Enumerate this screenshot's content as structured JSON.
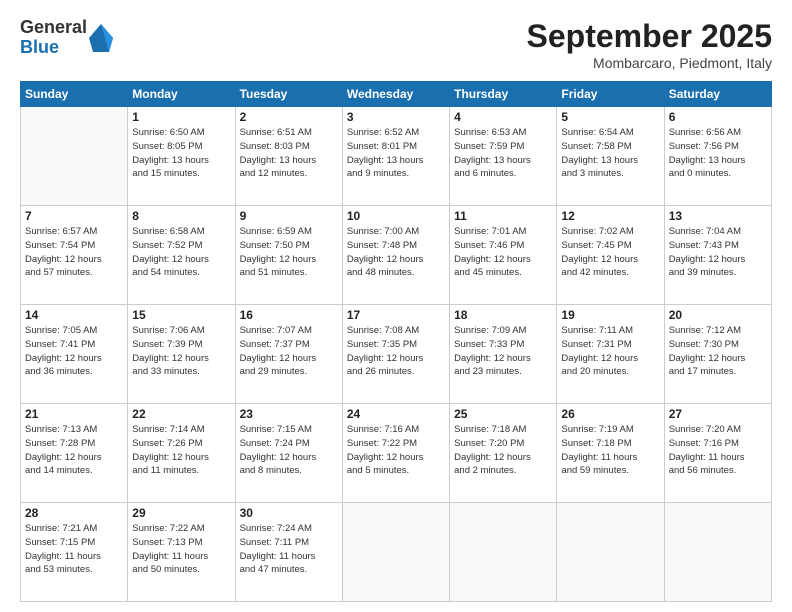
{
  "header": {
    "logo": {
      "general": "General",
      "blue": "Blue"
    },
    "title": "September 2025",
    "location": "Mombarcaro, Piedmont, Italy"
  },
  "weekdays": [
    "Sunday",
    "Monday",
    "Tuesday",
    "Wednesday",
    "Thursday",
    "Friday",
    "Saturday"
  ],
  "weeks": [
    [
      {
        "day": "",
        "info": ""
      },
      {
        "day": "1",
        "info": "Sunrise: 6:50 AM\nSunset: 8:05 PM\nDaylight: 13 hours\nand 15 minutes."
      },
      {
        "day": "2",
        "info": "Sunrise: 6:51 AM\nSunset: 8:03 PM\nDaylight: 13 hours\nand 12 minutes."
      },
      {
        "day": "3",
        "info": "Sunrise: 6:52 AM\nSunset: 8:01 PM\nDaylight: 13 hours\nand 9 minutes."
      },
      {
        "day": "4",
        "info": "Sunrise: 6:53 AM\nSunset: 7:59 PM\nDaylight: 13 hours\nand 6 minutes."
      },
      {
        "day": "5",
        "info": "Sunrise: 6:54 AM\nSunset: 7:58 PM\nDaylight: 13 hours\nand 3 minutes."
      },
      {
        "day": "6",
        "info": "Sunrise: 6:56 AM\nSunset: 7:56 PM\nDaylight: 13 hours\nand 0 minutes."
      }
    ],
    [
      {
        "day": "7",
        "info": "Sunrise: 6:57 AM\nSunset: 7:54 PM\nDaylight: 12 hours\nand 57 minutes."
      },
      {
        "day": "8",
        "info": "Sunrise: 6:58 AM\nSunset: 7:52 PM\nDaylight: 12 hours\nand 54 minutes."
      },
      {
        "day": "9",
        "info": "Sunrise: 6:59 AM\nSunset: 7:50 PM\nDaylight: 12 hours\nand 51 minutes."
      },
      {
        "day": "10",
        "info": "Sunrise: 7:00 AM\nSunset: 7:48 PM\nDaylight: 12 hours\nand 48 minutes."
      },
      {
        "day": "11",
        "info": "Sunrise: 7:01 AM\nSunset: 7:46 PM\nDaylight: 12 hours\nand 45 minutes."
      },
      {
        "day": "12",
        "info": "Sunrise: 7:02 AM\nSunset: 7:45 PM\nDaylight: 12 hours\nand 42 minutes."
      },
      {
        "day": "13",
        "info": "Sunrise: 7:04 AM\nSunset: 7:43 PM\nDaylight: 12 hours\nand 39 minutes."
      }
    ],
    [
      {
        "day": "14",
        "info": "Sunrise: 7:05 AM\nSunset: 7:41 PM\nDaylight: 12 hours\nand 36 minutes."
      },
      {
        "day": "15",
        "info": "Sunrise: 7:06 AM\nSunset: 7:39 PM\nDaylight: 12 hours\nand 33 minutes."
      },
      {
        "day": "16",
        "info": "Sunrise: 7:07 AM\nSunset: 7:37 PM\nDaylight: 12 hours\nand 29 minutes."
      },
      {
        "day": "17",
        "info": "Sunrise: 7:08 AM\nSunset: 7:35 PM\nDaylight: 12 hours\nand 26 minutes."
      },
      {
        "day": "18",
        "info": "Sunrise: 7:09 AM\nSunset: 7:33 PM\nDaylight: 12 hours\nand 23 minutes."
      },
      {
        "day": "19",
        "info": "Sunrise: 7:11 AM\nSunset: 7:31 PM\nDaylight: 12 hours\nand 20 minutes."
      },
      {
        "day": "20",
        "info": "Sunrise: 7:12 AM\nSunset: 7:30 PM\nDaylight: 12 hours\nand 17 minutes."
      }
    ],
    [
      {
        "day": "21",
        "info": "Sunrise: 7:13 AM\nSunset: 7:28 PM\nDaylight: 12 hours\nand 14 minutes."
      },
      {
        "day": "22",
        "info": "Sunrise: 7:14 AM\nSunset: 7:26 PM\nDaylight: 12 hours\nand 11 minutes."
      },
      {
        "day": "23",
        "info": "Sunrise: 7:15 AM\nSunset: 7:24 PM\nDaylight: 12 hours\nand 8 minutes."
      },
      {
        "day": "24",
        "info": "Sunrise: 7:16 AM\nSunset: 7:22 PM\nDaylight: 12 hours\nand 5 minutes."
      },
      {
        "day": "25",
        "info": "Sunrise: 7:18 AM\nSunset: 7:20 PM\nDaylight: 12 hours\nand 2 minutes."
      },
      {
        "day": "26",
        "info": "Sunrise: 7:19 AM\nSunset: 7:18 PM\nDaylight: 11 hours\nand 59 minutes."
      },
      {
        "day": "27",
        "info": "Sunrise: 7:20 AM\nSunset: 7:16 PM\nDaylight: 11 hours\nand 56 minutes."
      }
    ],
    [
      {
        "day": "28",
        "info": "Sunrise: 7:21 AM\nSunset: 7:15 PM\nDaylight: 11 hours\nand 53 minutes."
      },
      {
        "day": "29",
        "info": "Sunrise: 7:22 AM\nSunset: 7:13 PM\nDaylight: 11 hours\nand 50 minutes."
      },
      {
        "day": "30",
        "info": "Sunrise: 7:24 AM\nSunset: 7:11 PM\nDaylight: 11 hours\nand 47 minutes."
      },
      {
        "day": "",
        "info": ""
      },
      {
        "day": "",
        "info": ""
      },
      {
        "day": "",
        "info": ""
      },
      {
        "day": "",
        "info": ""
      }
    ]
  ]
}
